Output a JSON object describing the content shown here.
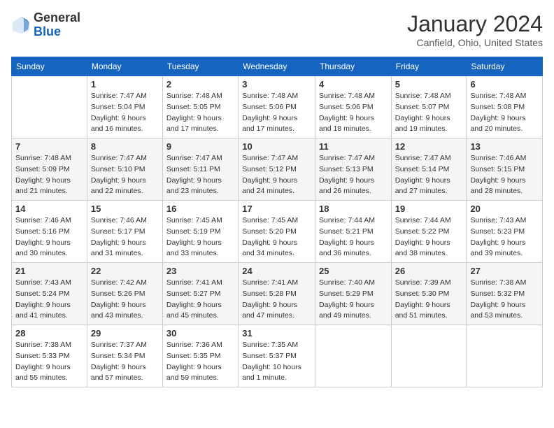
{
  "header": {
    "logo": {
      "general": "General",
      "blue": "Blue"
    },
    "title": "January 2024",
    "location": "Canfield, Ohio, United States"
  },
  "days_of_week": [
    "Sunday",
    "Monday",
    "Tuesday",
    "Wednesday",
    "Thursday",
    "Friday",
    "Saturday"
  ],
  "weeks": [
    [
      {
        "day": "",
        "info": ""
      },
      {
        "day": "1",
        "info": "Sunrise: 7:47 AM\nSunset: 5:04 PM\nDaylight: 9 hours and 16 minutes."
      },
      {
        "day": "2",
        "info": "Sunrise: 7:48 AM\nSunset: 5:05 PM\nDaylight: 9 hours and 17 minutes."
      },
      {
        "day": "3",
        "info": "Sunrise: 7:48 AM\nSunset: 5:06 PM\nDaylight: 9 hours and 17 minutes."
      },
      {
        "day": "4",
        "info": "Sunrise: 7:48 AM\nSunset: 5:06 PM\nDaylight: 9 hours and 18 minutes."
      },
      {
        "day": "5",
        "info": "Sunrise: 7:48 AM\nSunset: 5:07 PM\nDaylight: 9 hours and 19 minutes."
      },
      {
        "day": "6",
        "info": "Sunrise: 7:48 AM\nSunset: 5:08 PM\nDaylight: 9 hours and 20 minutes."
      }
    ],
    [
      {
        "day": "7",
        "info": "Sunrise: 7:48 AM\nSunset: 5:09 PM\nDaylight: 9 hours and 21 minutes."
      },
      {
        "day": "8",
        "info": "Sunrise: 7:47 AM\nSunset: 5:10 PM\nDaylight: 9 hours and 22 minutes."
      },
      {
        "day": "9",
        "info": "Sunrise: 7:47 AM\nSunset: 5:11 PM\nDaylight: 9 hours and 23 minutes."
      },
      {
        "day": "10",
        "info": "Sunrise: 7:47 AM\nSunset: 5:12 PM\nDaylight: 9 hours and 24 minutes."
      },
      {
        "day": "11",
        "info": "Sunrise: 7:47 AM\nSunset: 5:13 PM\nDaylight: 9 hours and 26 minutes."
      },
      {
        "day": "12",
        "info": "Sunrise: 7:47 AM\nSunset: 5:14 PM\nDaylight: 9 hours and 27 minutes."
      },
      {
        "day": "13",
        "info": "Sunrise: 7:46 AM\nSunset: 5:15 PM\nDaylight: 9 hours and 28 minutes."
      }
    ],
    [
      {
        "day": "14",
        "info": "Sunrise: 7:46 AM\nSunset: 5:16 PM\nDaylight: 9 hours and 30 minutes."
      },
      {
        "day": "15",
        "info": "Sunrise: 7:46 AM\nSunset: 5:17 PM\nDaylight: 9 hours and 31 minutes."
      },
      {
        "day": "16",
        "info": "Sunrise: 7:45 AM\nSunset: 5:19 PM\nDaylight: 9 hours and 33 minutes."
      },
      {
        "day": "17",
        "info": "Sunrise: 7:45 AM\nSunset: 5:20 PM\nDaylight: 9 hours and 34 minutes."
      },
      {
        "day": "18",
        "info": "Sunrise: 7:44 AM\nSunset: 5:21 PM\nDaylight: 9 hours and 36 minutes."
      },
      {
        "day": "19",
        "info": "Sunrise: 7:44 AM\nSunset: 5:22 PM\nDaylight: 9 hours and 38 minutes."
      },
      {
        "day": "20",
        "info": "Sunrise: 7:43 AM\nSunset: 5:23 PM\nDaylight: 9 hours and 39 minutes."
      }
    ],
    [
      {
        "day": "21",
        "info": "Sunrise: 7:43 AM\nSunset: 5:24 PM\nDaylight: 9 hours and 41 minutes."
      },
      {
        "day": "22",
        "info": "Sunrise: 7:42 AM\nSunset: 5:26 PM\nDaylight: 9 hours and 43 minutes."
      },
      {
        "day": "23",
        "info": "Sunrise: 7:41 AM\nSunset: 5:27 PM\nDaylight: 9 hours and 45 minutes."
      },
      {
        "day": "24",
        "info": "Sunrise: 7:41 AM\nSunset: 5:28 PM\nDaylight: 9 hours and 47 minutes."
      },
      {
        "day": "25",
        "info": "Sunrise: 7:40 AM\nSunset: 5:29 PM\nDaylight: 9 hours and 49 minutes."
      },
      {
        "day": "26",
        "info": "Sunrise: 7:39 AM\nSunset: 5:30 PM\nDaylight: 9 hours and 51 minutes."
      },
      {
        "day": "27",
        "info": "Sunrise: 7:38 AM\nSunset: 5:32 PM\nDaylight: 9 hours and 53 minutes."
      }
    ],
    [
      {
        "day": "28",
        "info": "Sunrise: 7:38 AM\nSunset: 5:33 PM\nDaylight: 9 hours and 55 minutes."
      },
      {
        "day": "29",
        "info": "Sunrise: 7:37 AM\nSunset: 5:34 PM\nDaylight: 9 hours and 57 minutes."
      },
      {
        "day": "30",
        "info": "Sunrise: 7:36 AM\nSunset: 5:35 PM\nDaylight: 9 hours and 59 minutes."
      },
      {
        "day": "31",
        "info": "Sunrise: 7:35 AM\nSunset: 5:37 PM\nDaylight: 10 hours and 1 minute."
      },
      {
        "day": "",
        "info": ""
      },
      {
        "day": "",
        "info": ""
      },
      {
        "day": "",
        "info": ""
      }
    ]
  ]
}
